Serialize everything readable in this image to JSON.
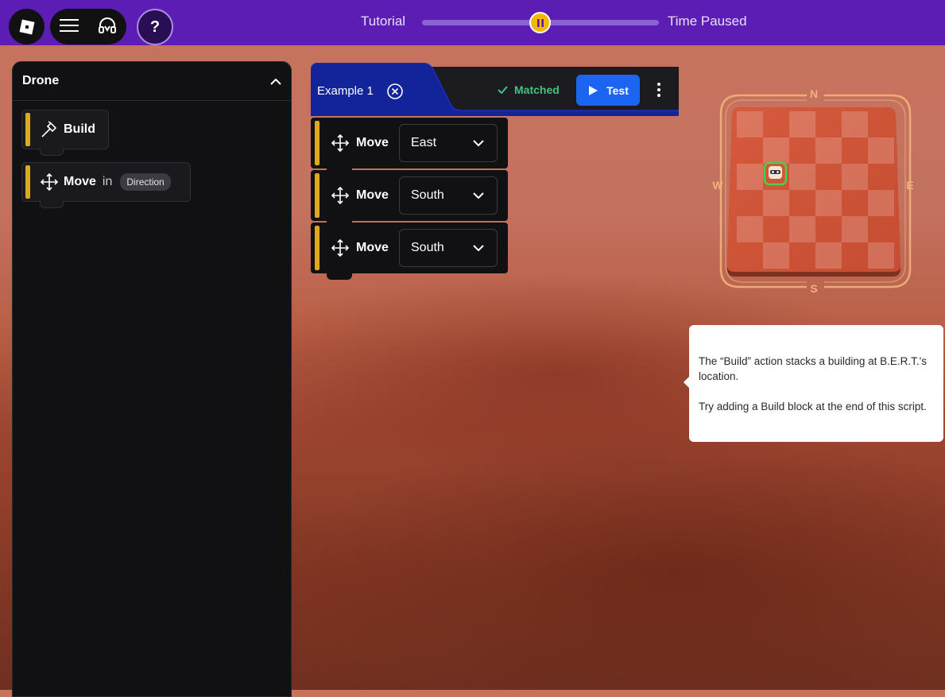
{
  "topbar": {
    "tutorial_label": "Tutorial",
    "time_label": "Time Paused",
    "progress_fraction": 0.5,
    "help_label": "?"
  },
  "panel": {
    "title": "Drone",
    "blocks": [
      {
        "label": "Build"
      },
      {
        "label": "Move",
        "connector": "in",
        "param": "Direction"
      }
    ]
  },
  "script": {
    "example_label": "Example 1",
    "status": "Matched",
    "test_label": "Test",
    "blocks": [
      {
        "label": "Move",
        "value": "East"
      },
      {
        "label": "Move",
        "value": "South"
      },
      {
        "label": "Move",
        "value": "South"
      }
    ]
  },
  "minimap": {
    "north": "N",
    "south": "S",
    "east": "E",
    "west": "W"
  },
  "tooltip": {
    "line1": "The “Build” action stacks a building at B.E.R.T.'s location.",
    "line2": "Try adding a Build block at the end of this script."
  },
  "colors": {
    "topbar": "#5b1db3",
    "accent_yellow": "#e0a81d",
    "test_blue": "#1c64f2",
    "matched_green": "#3fc47d"
  }
}
